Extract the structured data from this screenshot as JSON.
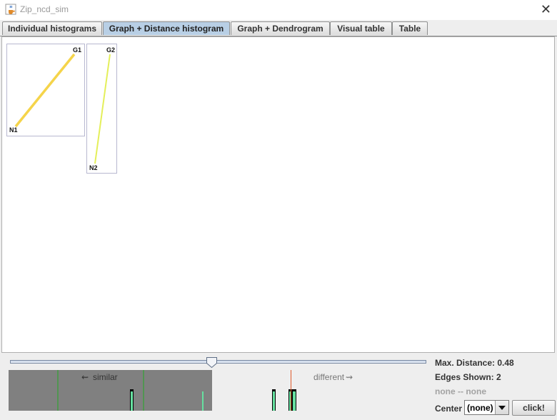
{
  "window": {
    "title": "Zip_ncd_sim",
    "app_icon": "java-cup-icon",
    "close_icon": "close-icon",
    "close_glyph": "✕"
  },
  "tabs": [
    {
      "label": "Individual histograms",
      "active": false
    },
    {
      "label": "Graph + Distance histogram",
      "active": true
    },
    {
      "label": "Graph + Dendrogram",
      "active": false
    },
    {
      "label": "Visual table",
      "active": false
    },
    {
      "label": "Table",
      "active": false
    }
  ],
  "graphs": [
    {
      "top_node": "G1",
      "bottom_node": "N1",
      "edge_color": "#f5d44a"
    },
    {
      "top_node": "G2",
      "bottom_node": "N2",
      "edge_color": "#e4ef5a"
    }
  ],
  "slider": {
    "label": "Max. Distance",
    "value": 0.48
  },
  "histogram": {
    "similar_label": "similar",
    "different_label": "different",
    "shaded_color": "#808080",
    "bar_color": "#66e0a0",
    "marker_color": "#22aa22",
    "cursor_color": "#e05a2a"
  },
  "info": {
    "max_distance": "Max. Distance: 0.48",
    "edges_shown": "Edges Shown: 2",
    "selection": "none -- none",
    "center_label": "Center"
  },
  "center_select": {
    "value": "(none)"
  },
  "click_button": {
    "label": "click!"
  }
}
